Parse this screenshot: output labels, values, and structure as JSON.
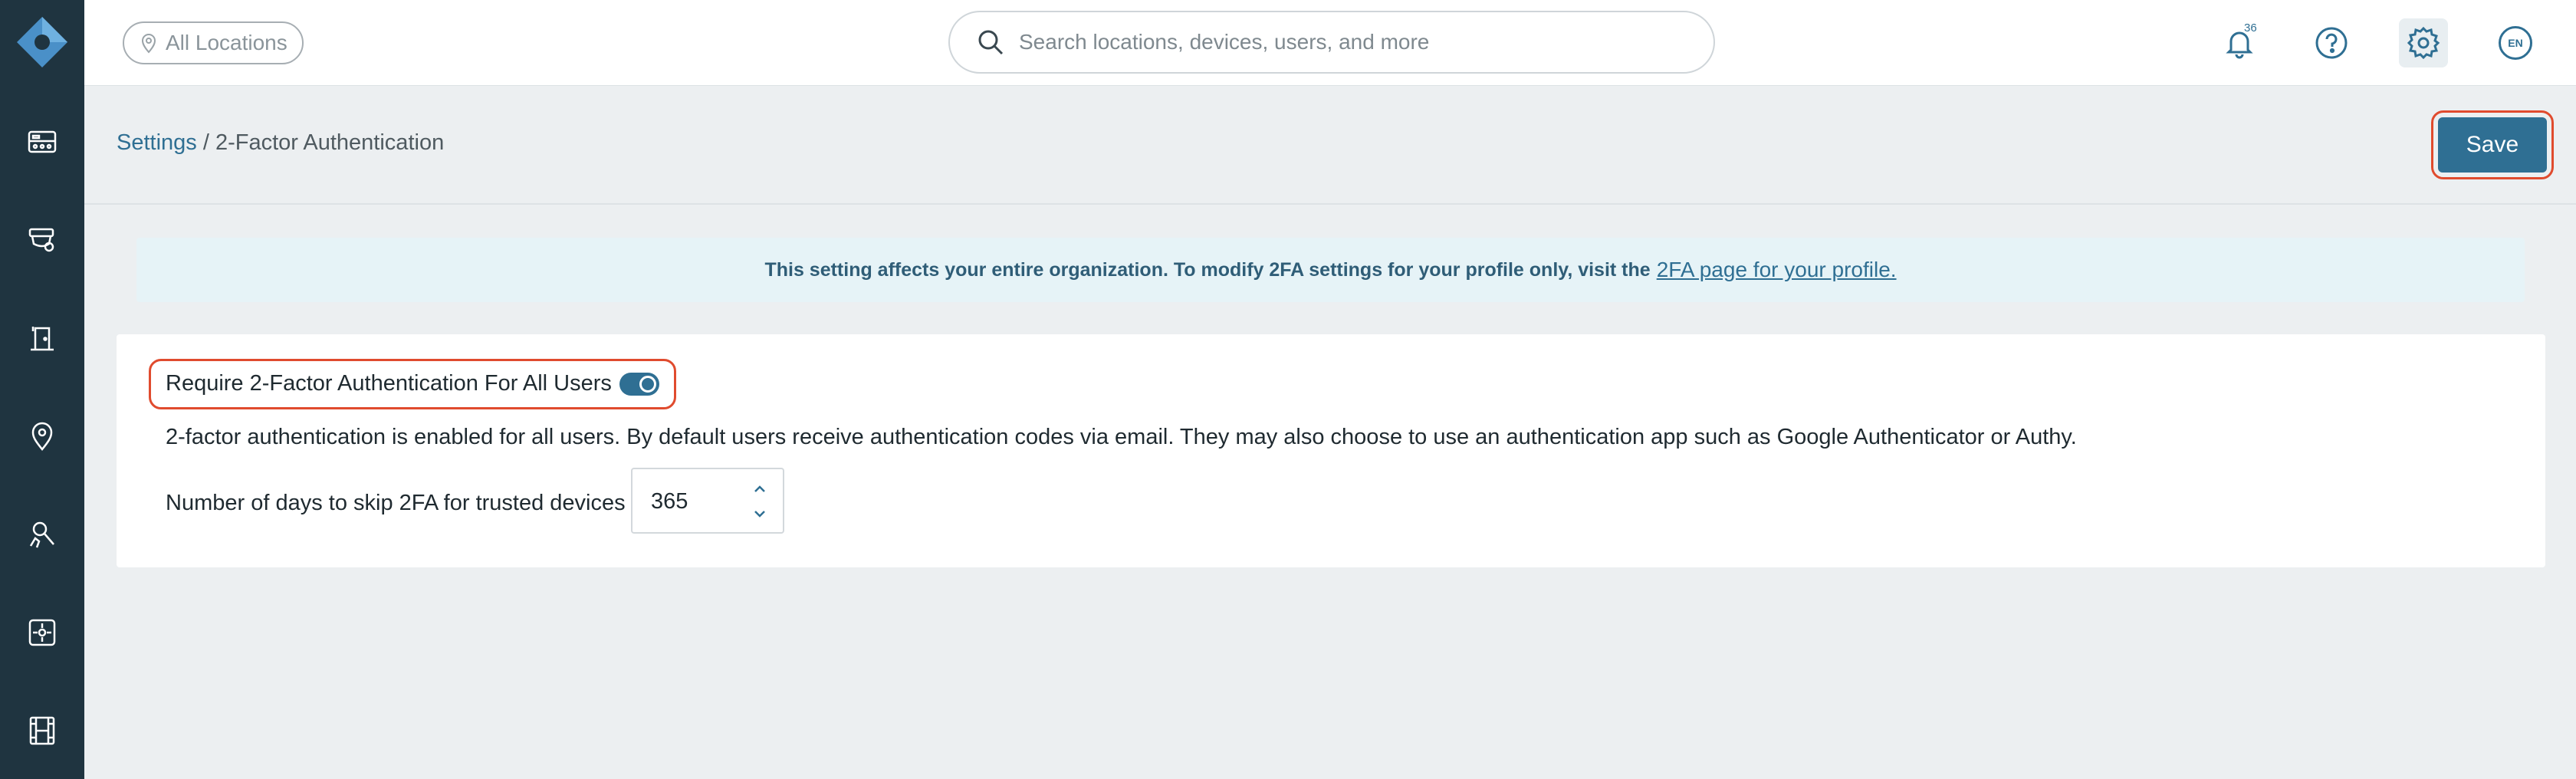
{
  "topbar": {
    "location_filter": "All Locations",
    "search_placeholder": "Search locations, devices, users, and more",
    "notification_count": "36",
    "language": "EN"
  },
  "sidebar": {
    "items": [
      {
        "icon": "dashboard-icon"
      },
      {
        "icon": "camera-icon"
      },
      {
        "icon": "door-access-icon"
      },
      {
        "icon": "location-pin-icon"
      },
      {
        "icon": "people-search-icon"
      },
      {
        "icon": "sensor-icon"
      },
      {
        "icon": "video-archive-icon"
      }
    ]
  },
  "header": {
    "breadcrumb_root": "Settings",
    "breadcrumb_separator": " / ",
    "breadcrumb_current": "2-Factor Authentication",
    "save_label": "Save"
  },
  "banner": {
    "text": "This setting affects your entire organization. To modify 2FA settings for your profile only, visit the",
    "link_text": "2FA page for your profile."
  },
  "settings": {
    "require_label": "Require 2-Factor Authentication For All Users",
    "require_enabled": true,
    "description": "2-factor authentication is enabled for all users. By default users receive authentication codes via email. They may also choose to use an authentication app such as Google Authenticator or Authy.",
    "skip_days_label": "Number of days to skip 2FA for trusted devices",
    "skip_days_value": "365"
  },
  "colors": {
    "sidebar_bg": "#1f3440",
    "accent": "#2f6f93",
    "highlight_ring": "#e04b2e",
    "banner_bg": "#e6f3f7",
    "page_bg": "#eceff1"
  }
}
